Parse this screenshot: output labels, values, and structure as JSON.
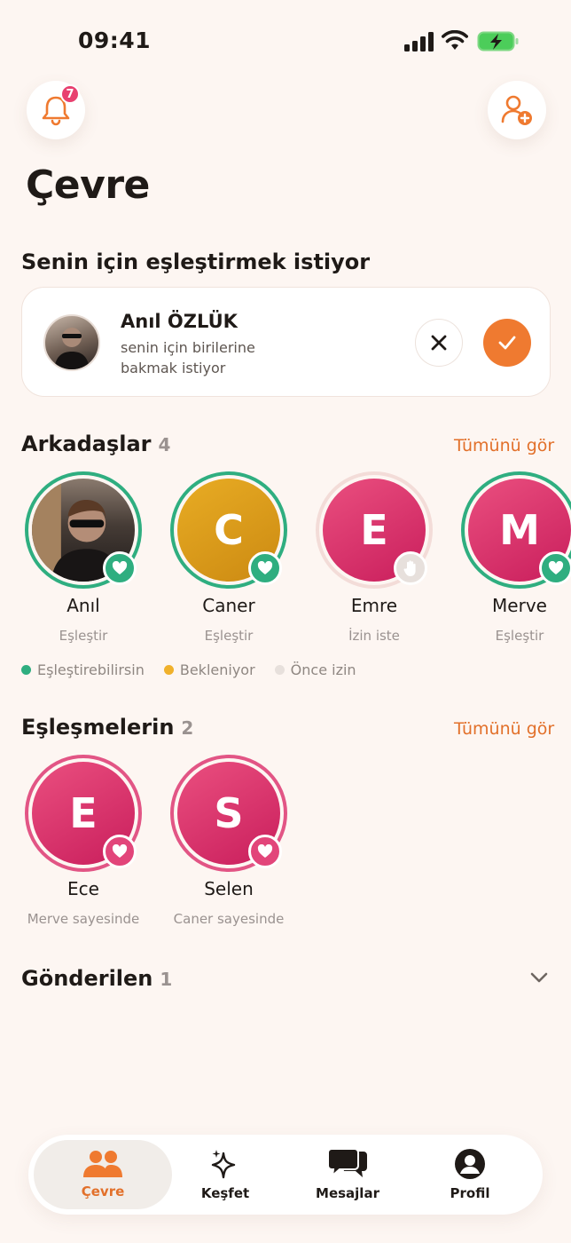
{
  "status_bar": {
    "time": "09:41"
  },
  "header": {
    "notification_count": "7"
  },
  "page": {
    "title": "Çevre"
  },
  "request_section": {
    "title": "Senin için eşleştirmek istiyor",
    "card": {
      "name": "Anıl ÖZLÜK",
      "text": "senin için birilerine bakmak istiyor"
    }
  },
  "friends": {
    "title": "Arkadaşlar",
    "count": "4",
    "see_all": "Tümünü gör",
    "items": [
      {
        "name": "Anıl",
        "action": "Eşleştir",
        "initial": ""
      },
      {
        "name": "Caner",
        "action": "Eşleştir",
        "initial": "C"
      },
      {
        "name": "Emre",
        "action": "İzin iste",
        "initial": "E"
      },
      {
        "name": "Merve",
        "action": "Eşleştir",
        "initial": "M"
      }
    ],
    "legend": [
      {
        "label": "Eşleştirebilirsin",
        "color": "#2fae80"
      },
      {
        "label": "Bekleniyor",
        "color": "#f0b12b"
      },
      {
        "label": "Önce izin",
        "color": "#e7e0dc"
      }
    ]
  },
  "matches": {
    "title": "Eşleşmelerin",
    "count": "2",
    "see_all": "Tümünü gör",
    "items": [
      {
        "name": "Ece",
        "via": "Merve sayesinde",
        "initial": "E"
      },
      {
        "name": "Selen",
        "via": "Caner sayesinde",
        "initial": "S"
      }
    ]
  },
  "sent": {
    "title": "Gönderilen",
    "count": "1"
  },
  "nav": {
    "items": [
      {
        "label": "Çevre",
        "icon": "people-icon",
        "active": true
      },
      {
        "label": "Keşfet",
        "icon": "sparkle-icon",
        "active": false
      },
      {
        "label": "Mesajlar",
        "icon": "chat-icon",
        "active": false
      },
      {
        "label": "Profil",
        "icon": "profile-icon",
        "active": false
      }
    ]
  },
  "colors": {
    "accent": "#ef7a30",
    "green": "#2fae80",
    "pink": "#e2457a",
    "gold": "#e8ac24"
  }
}
